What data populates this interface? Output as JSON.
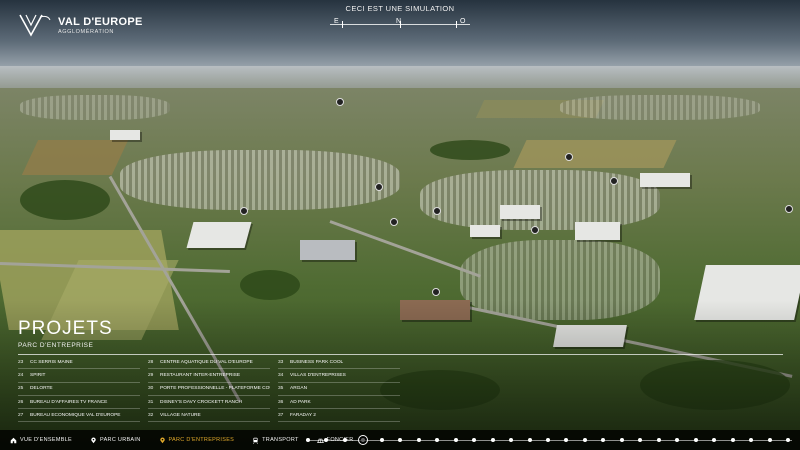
{
  "brand": {
    "title": "VAL D'EUROPE",
    "subtitle": "AGGLOMÉRATION"
  },
  "simulation": {
    "title": "CECI EST UNE SIMULATION"
  },
  "compass": {
    "left": "E",
    "center": "N",
    "right": "O"
  },
  "projects": {
    "title": "PROJETS",
    "subtitle": "PARC D'ENTREPRISE",
    "columns": [
      [
        {
          "num": "23",
          "label": "CC SERRIS MAINE"
        },
        {
          "num": "24",
          "label": "SPIRIT"
        },
        {
          "num": "25",
          "label": "DELORTE"
        },
        {
          "num": "26",
          "label": "BUREAU D'AFFAIRES TV FRANCE"
        },
        {
          "num": "27",
          "label": "BUREAU ÉCONOMIQUE VAL D'EUROPE"
        }
      ],
      [
        {
          "num": "28",
          "label": "CENTRE AQUATIQUE DU VAL D'EUROPE"
        },
        {
          "num": "29",
          "label": "RESTAURANT INTER-ENTREPRISE"
        },
        {
          "num": "30",
          "label": "PORTE PROFESSIONNELLE - PLATEFORME COURRIER"
        },
        {
          "num": "31",
          "label": "DISNEY'S DAVY CROCKETT RANCH"
        },
        {
          "num": "32",
          "label": "VILLAGE NATURE"
        }
      ],
      [
        {
          "num": "33",
          "label": "BUSINESS PARK COOL"
        },
        {
          "num": "34",
          "label": "VILLAS D'ENTREPRISES"
        },
        {
          "num": "35",
          "label": "ARGAN"
        },
        {
          "num": "36",
          "label": "AD PARK"
        },
        {
          "num": "37",
          "label": "FARADAY 2"
        }
      ]
    ]
  },
  "nav": [
    {
      "label": "VUE D'ENSEMBLE",
      "icon": "home-icon",
      "active": false
    },
    {
      "label": "PARC URBAIN",
      "icon": "location-pin-icon",
      "active": false
    },
    {
      "label": "PARC D'ENTREPRISES",
      "icon": "location-pin-icon",
      "active": true
    },
    {
      "label": "TRANSPORT",
      "icon": "train-icon",
      "active": false
    },
    {
      "label": "FONCIER",
      "icon": "land-icon",
      "active": false
    }
  ],
  "colors": {
    "active": "#e0a92b",
    "bar": "#000000"
  },
  "timeline": {
    "steps": 27,
    "current_step": 3
  }
}
